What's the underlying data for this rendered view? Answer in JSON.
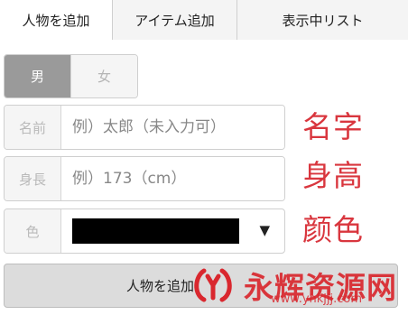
{
  "tabs": [
    {
      "label": "人物を追加",
      "active": true
    },
    {
      "label": "アイテム追加",
      "active": false
    },
    {
      "label": "表示中リスト",
      "active": false
    }
  ],
  "gender": {
    "male_label": "男",
    "female_label": "女",
    "selected": "男"
  },
  "form": {
    "name_label": "名前",
    "name_placeholder": "例）太郎（未入力可）",
    "height_label": "身長",
    "height_placeholder": "例）173（cm）",
    "color_label": "色",
    "color_value": "#000000",
    "dropdown_icon": "▼"
  },
  "annotations": {
    "name": "名字",
    "height": "身高",
    "color": "颜色"
  },
  "add_button": {
    "label": "人物を追加"
  },
  "watermark": {
    "text": "永辉资源网",
    "url": "www.yhkjjj.com",
    "color": "#d9272e"
  },
  "colors": {
    "annotation_red": "#d9363e",
    "male_selected_bg": "#9a9a9a"
  }
}
